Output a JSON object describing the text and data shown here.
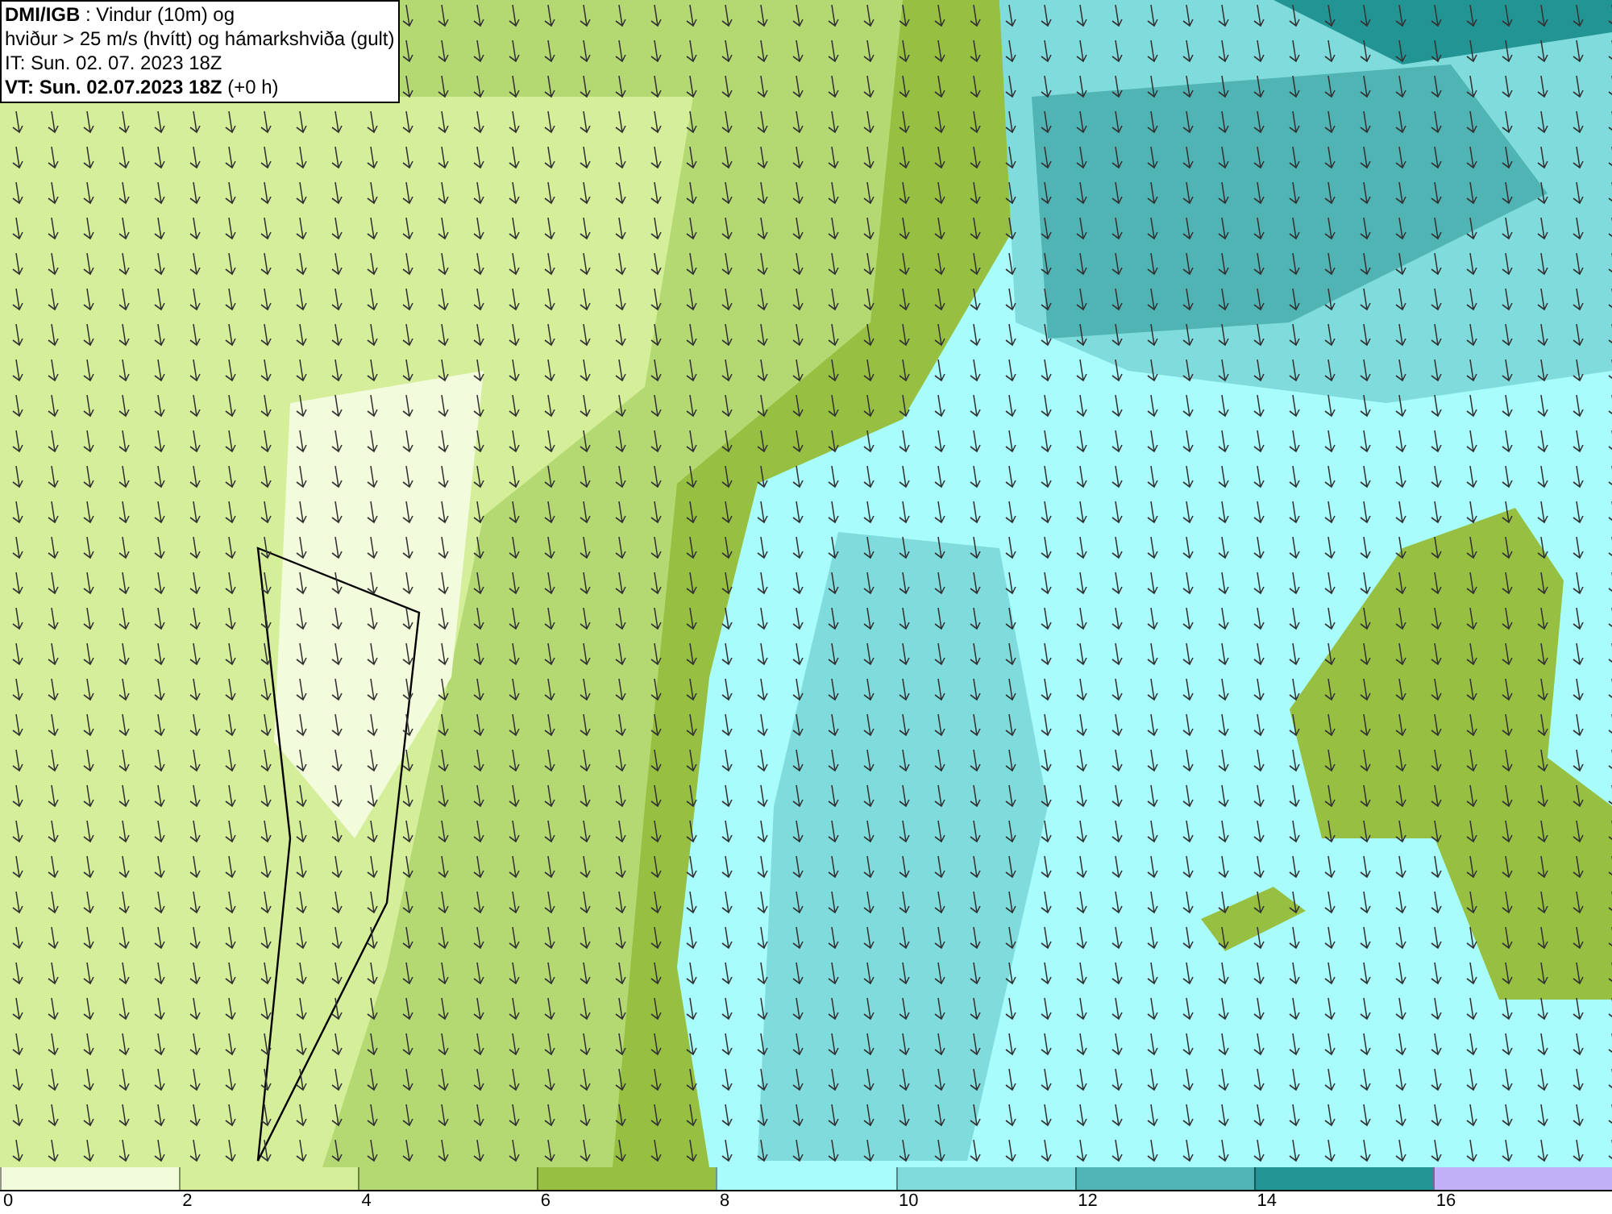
{
  "title_box": {
    "lines": [
      "**DMI/IGB** : Vindur (10m) og",
      "hviður > 25 m/s (hvítt) og hámarkshviða (gult)",
      "IT: Sun. 02. 07. 2023 18Z",
      "**VT: Sun. 02.07.2023 18Z** (+0 h)"
    ]
  },
  "legend": {
    "bins": [
      {
        "color": "#f2fbdc"
      },
      {
        "color": "#d4ee9a"
      },
      {
        "color": "#b5d972"
      },
      {
        "color": "#97c042"
      },
      {
        "color": "#a8fcfc"
      },
      {
        "color": "#80dcdc"
      },
      {
        "color": "#50b4b4"
      },
      {
        "color": "#229494"
      },
      {
        "color": "#c0b0f8"
      }
    ],
    "ticks": [
      "0",
      "2",
      "4",
      "6",
      "8",
      "10",
      "12",
      "14",
      "16"
    ]
  }
}
